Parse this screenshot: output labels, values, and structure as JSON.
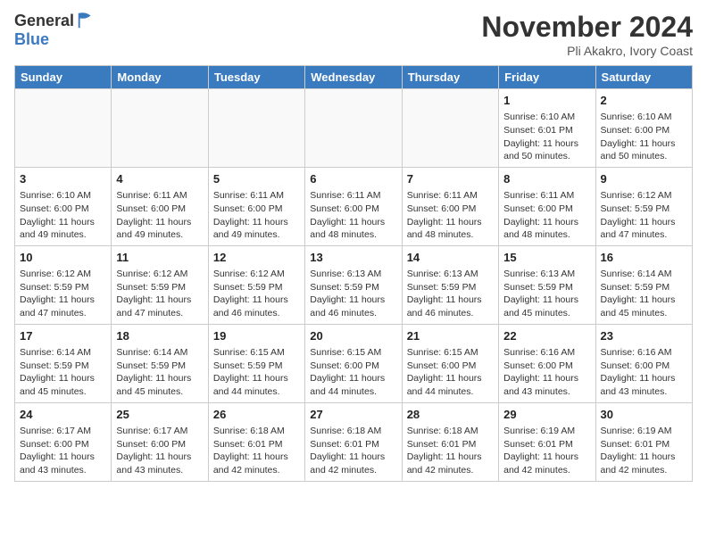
{
  "header": {
    "logo_general": "General",
    "logo_blue": "Blue",
    "month_title": "November 2024",
    "location": "Pli Akakro, Ivory Coast"
  },
  "days_of_week": [
    "Sunday",
    "Monday",
    "Tuesday",
    "Wednesday",
    "Thursday",
    "Friday",
    "Saturday"
  ],
  "weeks": [
    [
      {
        "day": "",
        "empty": true
      },
      {
        "day": "",
        "empty": true
      },
      {
        "day": "",
        "empty": true
      },
      {
        "day": "",
        "empty": true
      },
      {
        "day": "",
        "empty": true
      },
      {
        "day": "1",
        "sunrise": "Sunrise: 6:10 AM",
        "sunset": "Sunset: 6:01 PM",
        "daylight": "Daylight: 11 hours and 50 minutes."
      },
      {
        "day": "2",
        "sunrise": "Sunrise: 6:10 AM",
        "sunset": "Sunset: 6:00 PM",
        "daylight": "Daylight: 11 hours and 50 minutes."
      }
    ],
    [
      {
        "day": "3",
        "sunrise": "Sunrise: 6:10 AM",
        "sunset": "Sunset: 6:00 PM",
        "daylight": "Daylight: 11 hours and 49 minutes."
      },
      {
        "day": "4",
        "sunrise": "Sunrise: 6:11 AM",
        "sunset": "Sunset: 6:00 PM",
        "daylight": "Daylight: 11 hours and 49 minutes."
      },
      {
        "day": "5",
        "sunrise": "Sunrise: 6:11 AM",
        "sunset": "Sunset: 6:00 PM",
        "daylight": "Daylight: 11 hours and 49 minutes."
      },
      {
        "day": "6",
        "sunrise": "Sunrise: 6:11 AM",
        "sunset": "Sunset: 6:00 PM",
        "daylight": "Daylight: 11 hours and 48 minutes."
      },
      {
        "day": "7",
        "sunrise": "Sunrise: 6:11 AM",
        "sunset": "Sunset: 6:00 PM",
        "daylight": "Daylight: 11 hours and 48 minutes."
      },
      {
        "day": "8",
        "sunrise": "Sunrise: 6:11 AM",
        "sunset": "Sunset: 6:00 PM",
        "daylight": "Daylight: 11 hours and 48 minutes."
      },
      {
        "day": "9",
        "sunrise": "Sunrise: 6:12 AM",
        "sunset": "Sunset: 5:59 PM",
        "daylight": "Daylight: 11 hours and 47 minutes."
      }
    ],
    [
      {
        "day": "10",
        "sunrise": "Sunrise: 6:12 AM",
        "sunset": "Sunset: 5:59 PM",
        "daylight": "Daylight: 11 hours and 47 minutes."
      },
      {
        "day": "11",
        "sunrise": "Sunrise: 6:12 AM",
        "sunset": "Sunset: 5:59 PM",
        "daylight": "Daylight: 11 hours and 47 minutes."
      },
      {
        "day": "12",
        "sunrise": "Sunrise: 6:12 AM",
        "sunset": "Sunset: 5:59 PM",
        "daylight": "Daylight: 11 hours and 46 minutes."
      },
      {
        "day": "13",
        "sunrise": "Sunrise: 6:13 AM",
        "sunset": "Sunset: 5:59 PM",
        "daylight": "Daylight: 11 hours and 46 minutes."
      },
      {
        "day": "14",
        "sunrise": "Sunrise: 6:13 AM",
        "sunset": "Sunset: 5:59 PM",
        "daylight": "Daylight: 11 hours and 46 minutes."
      },
      {
        "day": "15",
        "sunrise": "Sunrise: 6:13 AM",
        "sunset": "Sunset: 5:59 PM",
        "daylight": "Daylight: 11 hours and 45 minutes."
      },
      {
        "day": "16",
        "sunrise": "Sunrise: 6:14 AM",
        "sunset": "Sunset: 5:59 PM",
        "daylight": "Daylight: 11 hours and 45 minutes."
      }
    ],
    [
      {
        "day": "17",
        "sunrise": "Sunrise: 6:14 AM",
        "sunset": "Sunset: 5:59 PM",
        "daylight": "Daylight: 11 hours and 45 minutes."
      },
      {
        "day": "18",
        "sunrise": "Sunrise: 6:14 AM",
        "sunset": "Sunset: 5:59 PM",
        "daylight": "Daylight: 11 hours and 45 minutes."
      },
      {
        "day": "19",
        "sunrise": "Sunrise: 6:15 AM",
        "sunset": "Sunset: 5:59 PM",
        "daylight": "Daylight: 11 hours and 44 minutes."
      },
      {
        "day": "20",
        "sunrise": "Sunrise: 6:15 AM",
        "sunset": "Sunset: 6:00 PM",
        "daylight": "Daylight: 11 hours and 44 minutes."
      },
      {
        "day": "21",
        "sunrise": "Sunrise: 6:15 AM",
        "sunset": "Sunset: 6:00 PM",
        "daylight": "Daylight: 11 hours and 44 minutes."
      },
      {
        "day": "22",
        "sunrise": "Sunrise: 6:16 AM",
        "sunset": "Sunset: 6:00 PM",
        "daylight": "Daylight: 11 hours and 43 minutes."
      },
      {
        "day": "23",
        "sunrise": "Sunrise: 6:16 AM",
        "sunset": "Sunset: 6:00 PM",
        "daylight": "Daylight: 11 hours and 43 minutes."
      }
    ],
    [
      {
        "day": "24",
        "sunrise": "Sunrise: 6:17 AM",
        "sunset": "Sunset: 6:00 PM",
        "daylight": "Daylight: 11 hours and 43 minutes."
      },
      {
        "day": "25",
        "sunrise": "Sunrise: 6:17 AM",
        "sunset": "Sunset: 6:00 PM",
        "daylight": "Daylight: 11 hours and 43 minutes."
      },
      {
        "day": "26",
        "sunrise": "Sunrise: 6:18 AM",
        "sunset": "Sunset: 6:01 PM",
        "daylight": "Daylight: 11 hours and 42 minutes."
      },
      {
        "day": "27",
        "sunrise": "Sunrise: 6:18 AM",
        "sunset": "Sunset: 6:01 PM",
        "daylight": "Daylight: 11 hours and 42 minutes."
      },
      {
        "day": "28",
        "sunrise": "Sunrise: 6:18 AM",
        "sunset": "Sunset: 6:01 PM",
        "daylight": "Daylight: 11 hours and 42 minutes."
      },
      {
        "day": "29",
        "sunrise": "Sunrise: 6:19 AM",
        "sunset": "Sunset: 6:01 PM",
        "daylight": "Daylight: 11 hours and 42 minutes."
      },
      {
        "day": "30",
        "sunrise": "Sunrise: 6:19 AM",
        "sunset": "Sunset: 6:01 PM",
        "daylight": "Daylight: 11 hours and 42 minutes."
      }
    ]
  ]
}
